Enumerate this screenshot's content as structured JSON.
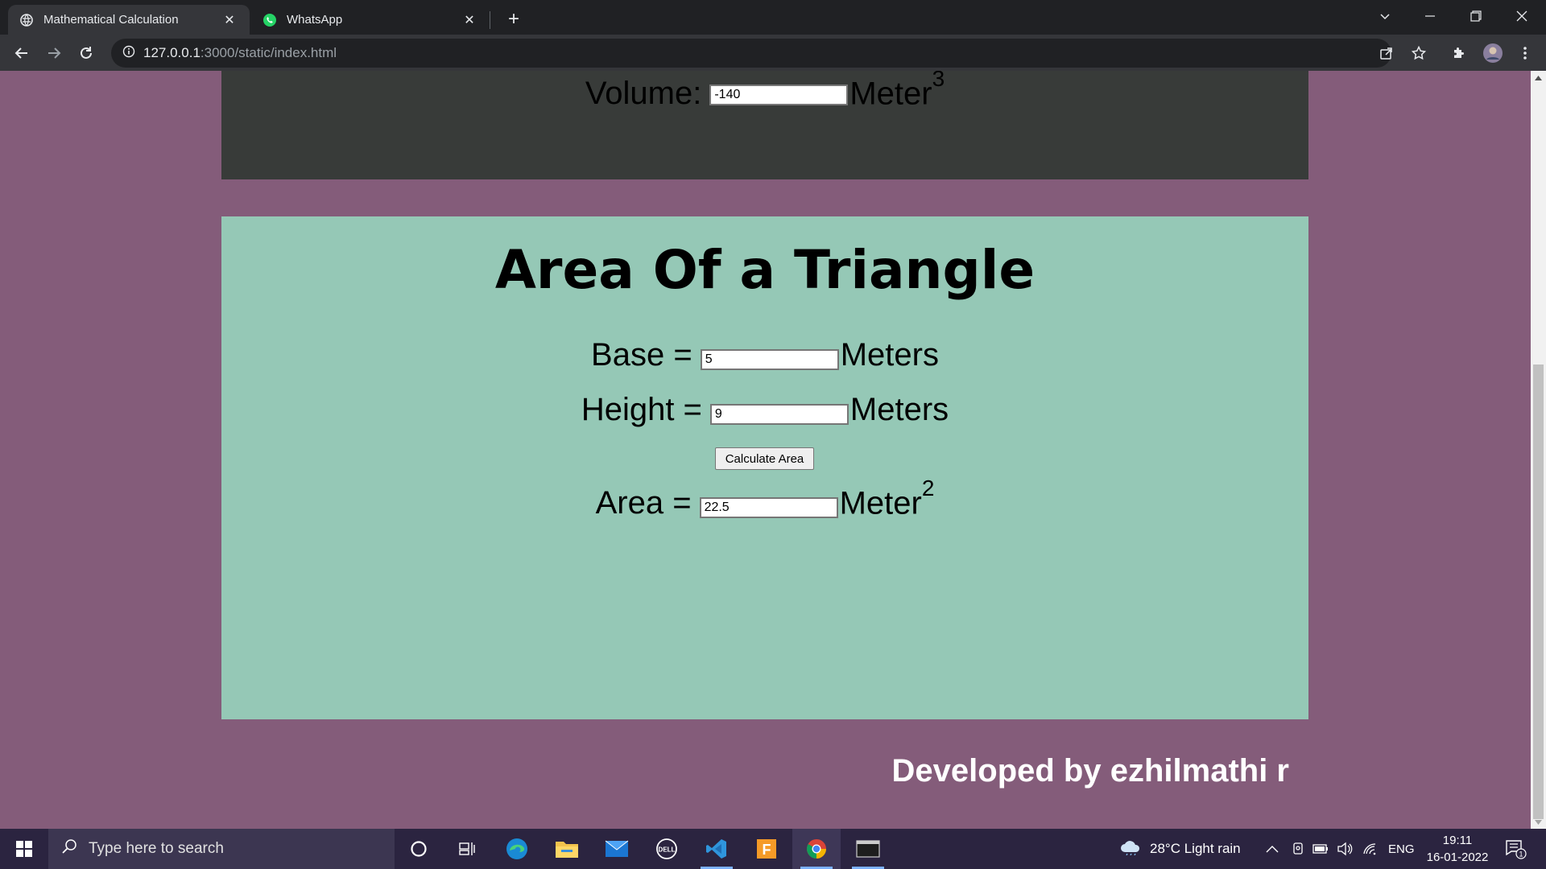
{
  "browser": {
    "tabs": [
      {
        "title": "Mathematical Calculation",
        "active": true
      },
      {
        "title": "WhatsApp",
        "active": false
      }
    ],
    "url_host": "127.0.0.1",
    "url_rest": ":3000/static/index.html"
  },
  "volume": {
    "label": "Volume:",
    "value": "-140",
    "unit": "Meter",
    "exponent": "3"
  },
  "triangle": {
    "title": "Area Of a Triangle",
    "base_label": "Base =",
    "base_value": "5",
    "base_unit": "Meters",
    "height_label": "Height =",
    "height_value": "9",
    "height_unit": "Meters",
    "button_label": "Calculate Area",
    "area_label": "Area =",
    "area_value": "22.5",
    "area_unit": "Meter",
    "area_exponent": "2"
  },
  "footer": {
    "text": "Developed by ezhilmathi r"
  },
  "taskbar": {
    "search_placeholder": "Type here to search",
    "weather": "28°C  Light rain",
    "language": "ENG",
    "time": "19:11",
    "date": "16-01-2022",
    "notification_count": "1"
  },
  "colors": {
    "page_bg": "#845c7a",
    "volume_card_bg": "#383b39",
    "triangle_card_bg": "#95c8b6",
    "footer_text": "#ffffff"
  }
}
